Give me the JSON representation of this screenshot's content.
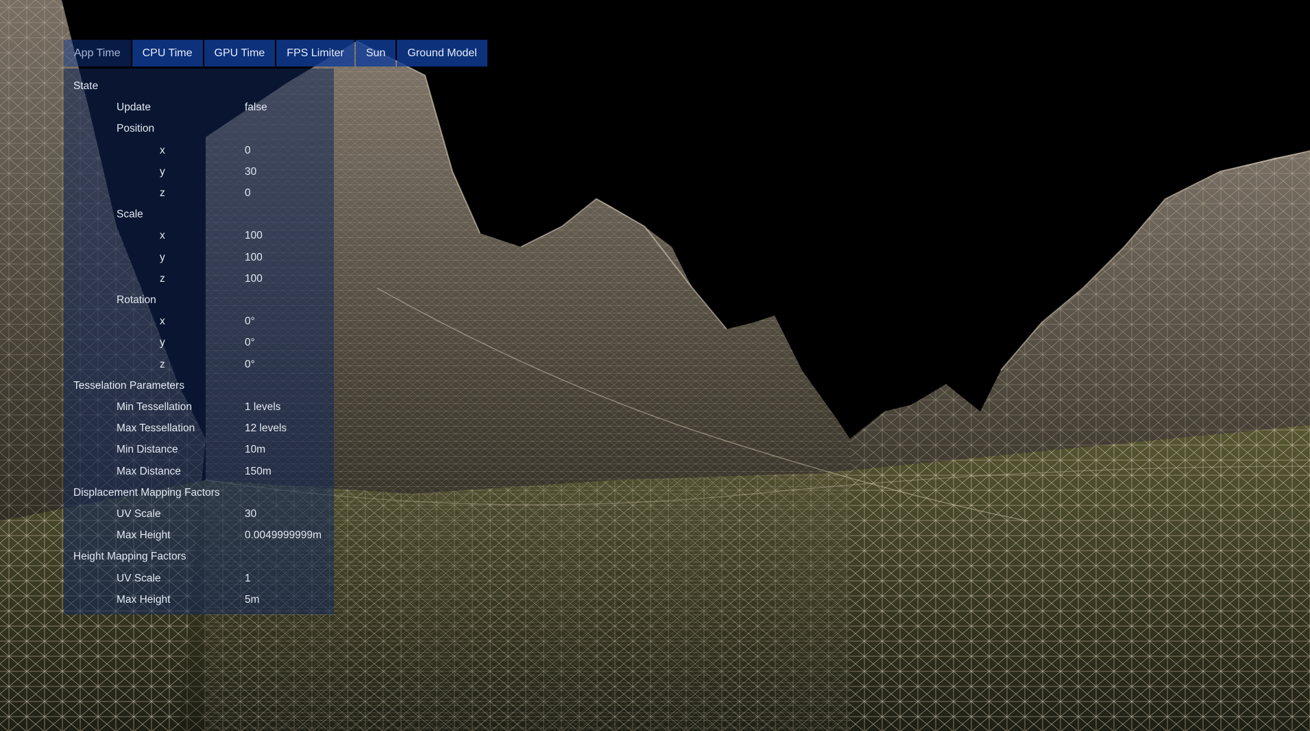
{
  "tabs": [
    {
      "label": "App Time",
      "active": false
    },
    {
      "label": "CPU Time",
      "active": true
    },
    {
      "label": "GPU Time",
      "active": true
    },
    {
      "label": "FPS Limiter",
      "active": true
    },
    {
      "label": "Sun",
      "active": true
    },
    {
      "label": "Ground Model",
      "active": true
    }
  ],
  "panel": {
    "rows": [
      {
        "key": "State",
        "value": "",
        "level": 0
      },
      {
        "key": "Update",
        "value": "false",
        "level": 1
      },
      {
        "key": "Position",
        "value": "",
        "level": 1
      },
      {
        "key": "x",
        "value": "0",
        "level": 2
      },
      {
        "key": "y",
        "value": "30",
        "level": 2
      },
      {
        "key": "z",
        "value": "0",
        "level": 2
      },
      {
        "key": "Scale",
        "value": "",
        "level": 1
      },
      {
        "key": "x",
        "value": "100",
        "level": 2
      },
      {
        "key": "y",
        "value": "100",
        "level": 2
      },
      {
        "key": "z",
        "value": "100",
        "level": 2
      },
      {
        "key": "Rotation",
        "value": "",
        "level": 1
      },
      {
        "key": "x",
        "value": "0°",
        "level": 2
      },
      {
        "key": "y",
        "value": "0°",
        "level": 2
      },
      {
        "key": "z",
        "value": "0°",
        "level": 2
      },
      {
        "key": "Tesselation Parameters",
        "value": "",
        "level": 0
      },
      {
        "key": "Min Tessellation",
        "value": "1 levels",
        "level": 1
      },
      {
        "key": "Max Tessellation",
        "value": "12 levels",
        "level": 1
      },
      {
        "key": "Min Distance",
        "value": "10m",
        "level": 1
      },
      {
        "key": "Max Distance",
        "value": "150m",
        "level": 1
      },
      {
        "key": "Displacement Mapping Factors",
        "value": "",
        "level": 0
      },
      {
        "key": "UV Scale",
        "value": "30",
        "level": 1
      },
      {
        "key": "Max Height",
        "value": "0.0049999999m",
        "level": 1
      },
      {
        "key": "Height Mapping Factors",
        "value": "",
        "level": 0
      },
      {
        "key": "UV Scale",
        "value": "1",
        "level": 1
      },
      {
        "key": "Max Height",
        "value": "5m",
        "level": 1
      }
    ]
  },
  "colors": {
    "tab_active": "#103c96",
    "wire_light": "#c9bba7",
    "wire_grass": "#6f7a36",
    "background": "#000000"
  }
}
